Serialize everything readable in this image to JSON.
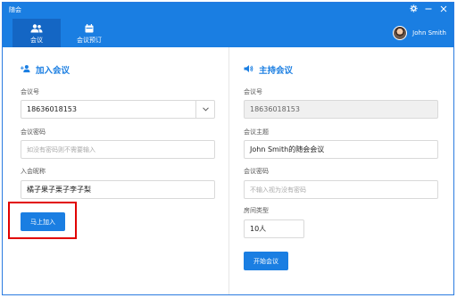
{
  "app": {
    "title": "随会"
  },
  "nav": {
    "tabs": [
      {
        "label": "会议",
        "icon": "people-icon"
      },
      {
        "label": "会议预订",
        "icon": "calendar-icon"
      }
    ]
  },
  "user": {
    "name": "John Smith"
  },
  "window_controls": [
    "settings-icon",
    "minimize-icon",
    "close-icon"
  ],
  "join": {
    "title": "加入会议",
    "meeting_id": {
      "label": "会议号",
      "value": "18636018153"
    },
    "password": {
      "label": "会议密码",
      "placeholder": "如没有密码则不需要输入"
    },
    "nickname": {
      "label": "入会昵称",
      "value": "橘子果子栗子李子梨"
    },
    "join_button": "马上加入"
  },
  "host": {
    "title": "主持会议",
    "meeting_id": {
      "label": "会议号",
      "value": "18636018153"
    },
    "topic": {
      "label": "会议主题",
      "value": "John Smith的随会会议"
    },
    "password": {
      "label": "会议密码",
      "placeholder": "不输入视为没有密码"
    },
    "room_type": {
      "label": "房间类型",
      "value": "10人"
    },
    "start_button": "开始会议"
  },
  "colors": {
    "primary": "#1a7ee2",
    "highlight": "#e10000"
  }
}
